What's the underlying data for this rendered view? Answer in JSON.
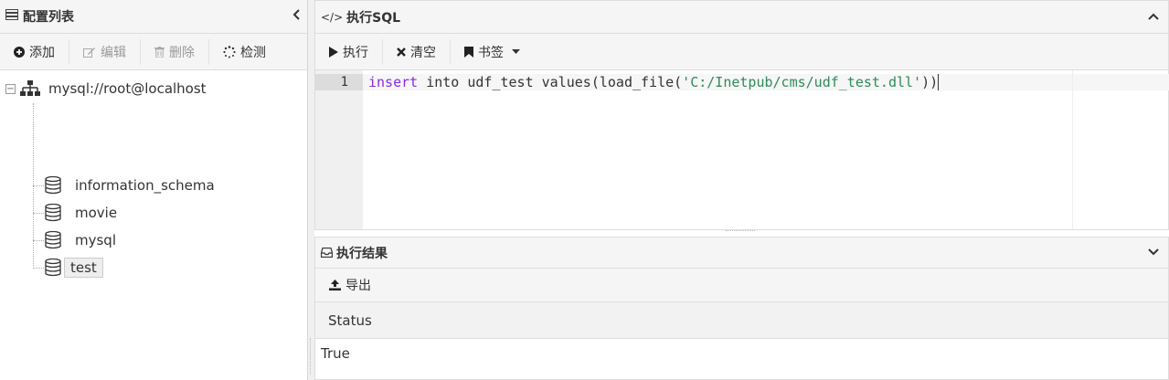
{
  "left_panel": {
    "title": "配置列表",
    "toolbar": {
      "add": "添加",
      "edit": "编辑",
      "delete": "删除",
      "check": "检测"
    },
    "tree": {
      "root": "mysql://root@localhost",
      "items": [
        "information_schema",
        "movie",
        "mysql",
        "test"
      ],
      "selected": "test"
    }
  },
  "sql_panel": {
    "title": "执行SQL",
    "toolbar": {
      "run": "执行",
      "clear": "清空",
      "bookmark": "书签"
    },
    "editor": {
      "line_number": "1",
      "code_keyword": "insert",
      "code_middle": " into udf_test values(load_file(",
      "code_string": "'C:/Inetpub/cms/udf_test.dll'",
      "code_end": "))"
    }
  },
  "result_panel": {
    "title": "执行结果",
    "toolbar": {
      "export": "导出"
    },
    "columns": [
      "Status"
    ],
    "rows": [
      [
        "True"
      ]
    ]
  }
}
